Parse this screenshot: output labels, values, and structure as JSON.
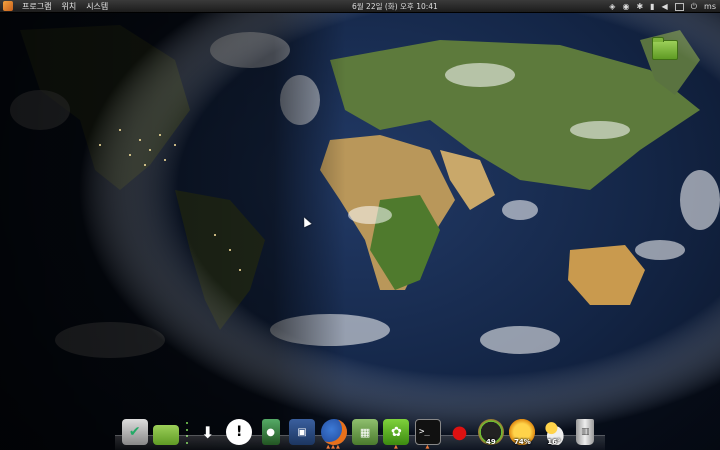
{
  "top_panel": {
    "menus": [
      "프로그램",
      "위치",
      "시스템"
    ],
    "clock": "6월 22일 (화) 오후 10:41",
    "tray": {
      "user": "ms",
      "icons": [
        "dropbox-icon",
        "wifi-icon",
        "butterfly-icon",
        "signal-icon",
        "volume-icon",
        "mail-icon",
        "power-icon"
      ]
    }
  },
  "desktop": {
    "icon_label": ""
  },
  "dock": {
    "items": [
      {
        "name": "files-app-icon",
        "badge": ""
      },
      {
        "name": "folder-icon",
        "badge": ""
      },
      {
        "name": "download-icon",
        "badge": ""
      },
      {
        "name": "chat-bubble-icon",
        "badge": ""
      },
      {
        "name": "ipod-icon",
        "badge": ""
      },
      {
        "name": "floppy-icon",
        "badge": ""
      },
      {
        "name": "firefox-icon",
        "badge": ""
      },
      {
        "name": "calculator-icon",
        "badge": ""
      },
      {
        "name": "ubuntu-software-icon",
        "badge": ""
      },
      {
        "name": "terminal-icon",
        "badge": ""
      },
      {
        "name": "cherry-icon",
        "badge": ""
      },
      {
        "name": "gauge-icon",
        "badge": "49"
      },
      {
        "name": "sun-weather-icon",
        "badge": "74%"
      },
      {
        "name": "cloud-weather-icon",
        "badge": "16°"
      },
      {
        "name": "trash-icon",
        "badge": ""
      }
    ]
  },
  "colors": {
    "panel_bg": "#2a2a2a",
    "dock_accent": "#7ed957",
    "ocean": "#142647"
  }
}
